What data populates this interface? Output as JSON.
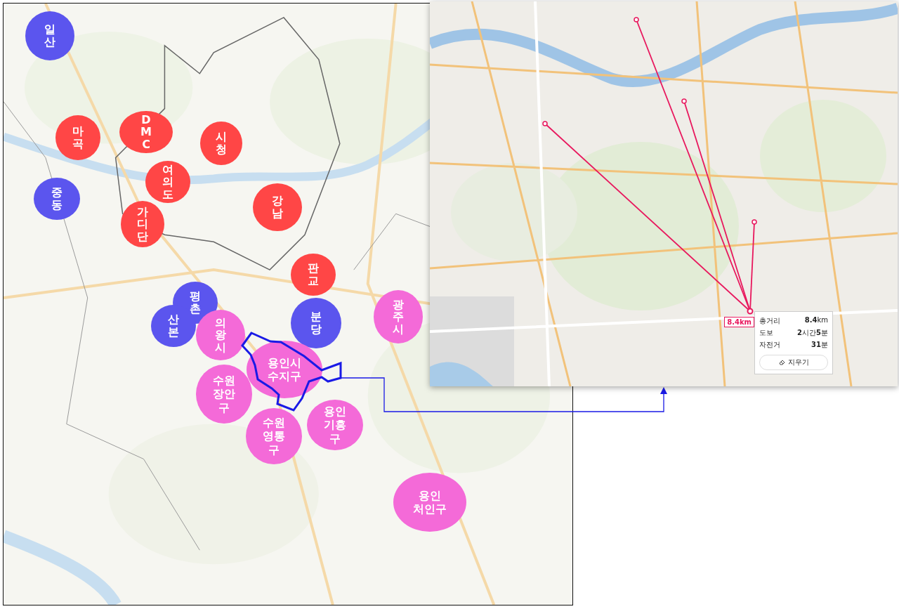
{
  "region_map": {
    "regions": [
      {
        "kind": "vertical",
        "label": "일산",
        "color": "#5b55ee"
      },
      {
        "kind": "vertical",
        "label": "마곡",
        "color": "#ff4646"
      },
      {
        "kind": "vertical",
        "label": "DMC",
        "color": "#ff4646"
      },
      {
        "kind": "vertical",
        "label": "시청",
        "color": "#ff4646"
      },
      {
        "kind": "vertical",
        "label": "여의도",
        "color": "#ff4646"
      },
      {
        "kind": "vertical",
        "label": "중동",
        "color": "#5b55ee"
      },
      {
        "kind": "vertical",
        "label": "가디단",
        "color": "#ff4646"
      },
      {
        "kind": "vertical",
        "label": "강남",
        "color": "#ff4646"
      },
      {
        "kind": "vertical",
        "label": "판교",
        "color": "#ff4646"
      },
      {
        "kind": "vertical",
        "label": "평촌",
        "color": "#5b55ee"
      },
      {
        "kind": "vertical",
        "label": "산본",
        "color": "#5b55ee"
      },
      {
        "kind": "vertical",
        "label": "의왕시",
        "color": "#f46ad8"
      },
      {
        "kind": "vertical",
        "label": "분당",
        "color": "#5b55ee"
      },
      {
        "kind": "vertical",
        "label": "광주시",
        "color": "#f46ad8"
      },
      {
        "kind": "stacked",
        "lines": [
          "용인시",
          "수지구"
        ],
        "color": "#f46ad8"
      },
      {
        "kind": "stacked",
        "lines": [
          "수원",
          "장안",
          "구"
        ],
        "color": "#f46ad8"
      },
      {
        "kind": "stacked",
        "lines": [
          "수원",
          "영통",
          "구"
        ],
        "color": "#f46ad8"
      },
      {
        "kind": "stacked",
        "lines": [
          "용인",
          "기흥",
          "구"
        ],
        "color": "#f46ad8"
      },
      {
        "kind": "stacked",
        "lines": [
          "용인",
          "처인구"
        ],
        "color": "#f46ad8"
      }
    ]
  },
  "route_map": {
    "distance_label": "8.4km",
    "summary": [
      {
        "label": "총거리",
        "value": "**8.4**km"
      },
      {
        "label": "도보",
        "value": "**2**시간**5**분"
      },
      {
        "label": "자전거",
        "value": "**31**분"
      }
    ],
    "clear_button": "지우기"
  }
}
